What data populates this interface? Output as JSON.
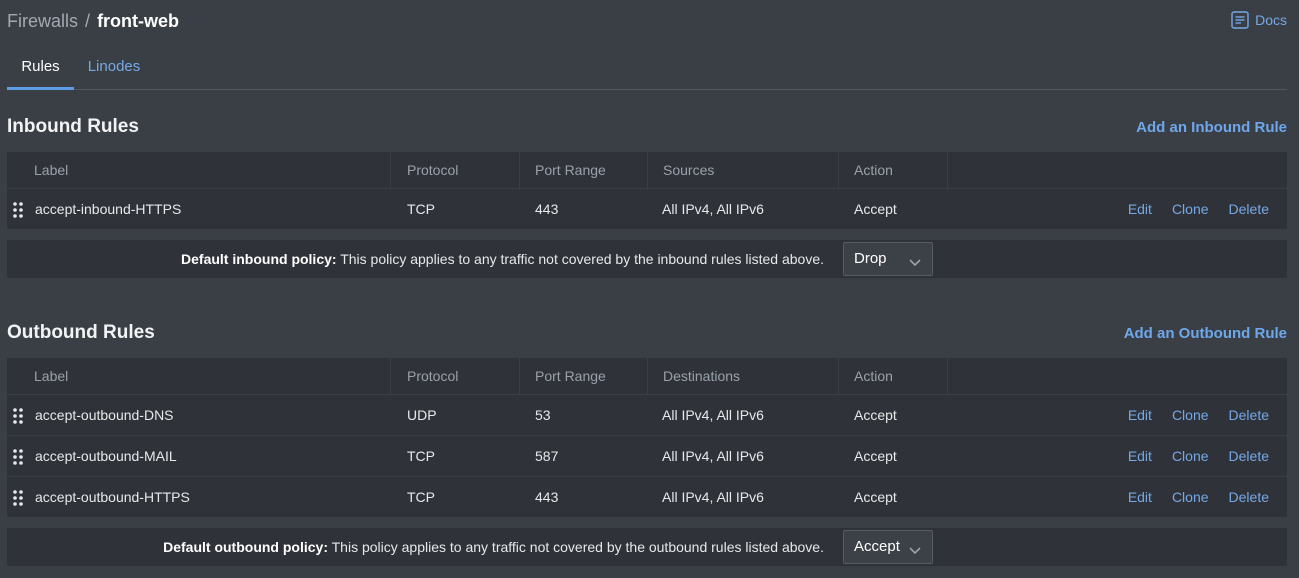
{
  "breadcrumb": {
    "parent": "Firewalls",
    "separator": "/",
    "current": "front-web"
  },
  "docs": {
    "label": "Docs",
    "icon": "document-icon"
  },
  "tabs": [
    {
      "label": "Rules",
      "active": true
    },
    {
      "label": "Linodes",
      "active": false
    }
  ],
  "inbound": {
    "title": "Inbound Rules",
    "add_label": "Add an Inbound Rule",
    "columns": [
      "Label",
      "Protocol",
      "Port Range",
      "Sources",
      "Action"
    ],
    "rows": [
      {
        "label": "accept-inbound-HTTPS",
        "protocol": "TCP",
        "ports": "443",
        "addresses": "All IPv4, All IPv6",
        "action": "Accept"
      }
    ],
    "policy_bold": "Default inbound policy:",
    "policy_text": " This policy applies to any traffic not covered by the inbound rules listed above.",
    "policy_value": "Drop"
  },
  "outbound": {
    "title": "Outbound Rules",
    "add_label": "Add an Outbound Rule",
    "columns": [
      "Label",
      "Protocol",
      "Port Range",
      "Destinations",
      "Action"
    ],
    "rows": [
      {
        "label": "accept-outbound-DNS",
        "protocol": "UDP",
        "ports": "53",
        "addresses": "All IPv4, All IPv6",
        "action": "Accept"
      },
      {
        "label": "accept-outbound-MAIL",
        "protocol": "TCP",
        "ports": "587",
        "addresses": "All IPv4, All IPv6",
        "action": "Accept"
      },
      {
        "label": "accept-outbound-HTTPS",
        "protocol": "TCP",
        "ports": "443",
        "addresses": "All IPv4, All IPv6",
        "action": "Accept"
      }
    ],
    "policy_bold": "Default outbound policy:",
    "policy_text": " This policy applies to any traffic not covered by the outbound rules listed above.",
    "policy_value": "Accept"
  },
  "row_actions": {
    "edit": "Edit",
    "clone": "Clone",
    "delete": "Delete"
  },
  "colors": {
    "background": "#3a3f46",
    "panel": "#2f3339",
    "link": "#75a8e6",
    "tab_indicator": "#5e9ee6"
  }
}
